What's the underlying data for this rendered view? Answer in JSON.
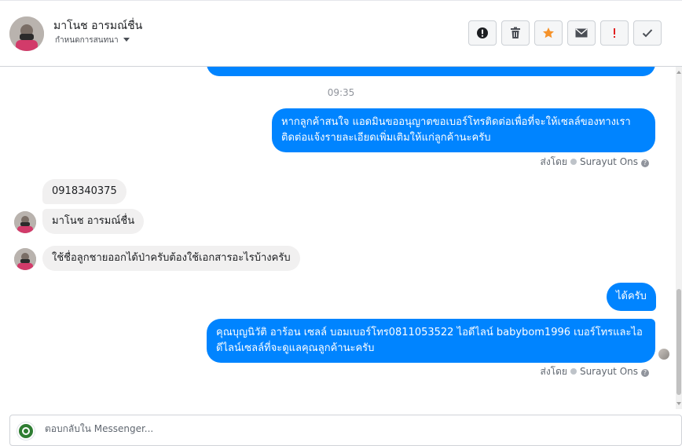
{
  "header": {
    "contact_name": "มาโนช อารมณ์ชื่น",
    "status_label": "กำหนดการสนทนา",
    "toolbar": [
      {
        "name": "alert-circle",
        "color": "#1c1e21"
      },
      {
        "name": "trash",
        "color": "#1c1e21"
      },
      {
        "name": "star",
        "color": "#f5a623"
      },
      {
        "name": "envelope",
        "color": "#1c1e21"
      },
      {
        "name": "exclamation",
        "color": "#e02020"
      },
      {
        "name": "check",
        "color": "#1c1e21"
      }
    ]
  },
  "conversation": {
    "timestamp": "09:35",
    "messages": [
      {
        "from": "page",
        "text": "หากลูกค้าสนใจ แอดมินขออนุญาตขอเบอร์โทรติดต่อเพื่อที่จะให้เซลล์ของทางเราติดต่อแจ้งรายละเอียดเพิ่มเติมให้แก่ลูกค้านะครับ"
      },
      {
        "from": "customer",
        "text": "0918340375"
      },
      {
        "from": "customer",
        "text": "มาโนช อารมณ์ชื่น"
      },
      {
        "from": "customer",
        "text": "ใช้ชื่อลูกชายออกได้ป่าครับต้องใช้เอกสารอะไรบ้างครับ"
      },
      {
        "from": "page",
        "text": "ได้ครับ"
      },
      {
        "from": "page",
        "text": "คุณบุญนิวัติ อาร้อน เซลล์ บอมเบอร์โทร0811053522 ไอดีไลน์ babybom1996  เบอร์โทรและไอดีไลน์เซลล์ที่จะดูแลคุณลูกค้านะครับ"
      }
    ],
    "sent_by_prefix": "ส่งโดย",
    "sent_by_name": "Surayut Ons"
  },
  "composer": {
    "placeholder": "ตอบกลับใน Messenger..."
  },
  "colors": {
    "outgoing_bubble": "#0084ff",
    "incoming_bubble": "#f1f0f0"
  }
}
